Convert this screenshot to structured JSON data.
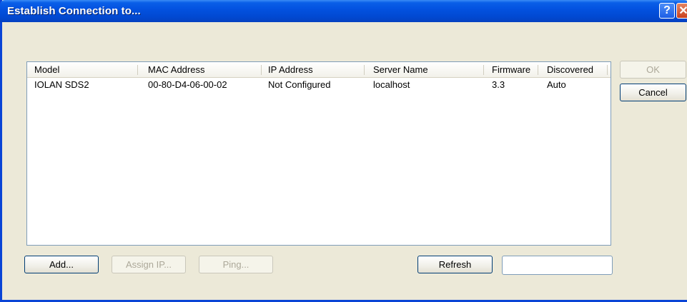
{
  "window": {
    "title": "Establish Connection to...",
    "help_glyph": "?",
    "close_glyph": "✕"
  },
  "list": {
    "columns": [
      "Model",
      "MAC Address",
      "IP Address",
      "Server Name",
      "Firmware",
      "Discovered"
    ],
    "rows": [
      [
        "IOLAN SDS2",
        "00-80-D4-06-00-02",
        "Not Configured",
        "localhost",
        "3.3",
        "Auto"
      ]
    ]
  },
  "buttons": {
    "ok": "OK",
    "cancel": "Cancel",
    "add": "Add...",
    "assign_ip": "Assign IP...",
    "ping": "Ping...",
    "refresh": "Refresh"
  },
  "status_field": {
    "value": ""
  },
  "colors": {
    "titlebar": "#0352e0",
    "dialog_bg": "#ece9d8",
    "button_border": "#003c74"
  }
}
